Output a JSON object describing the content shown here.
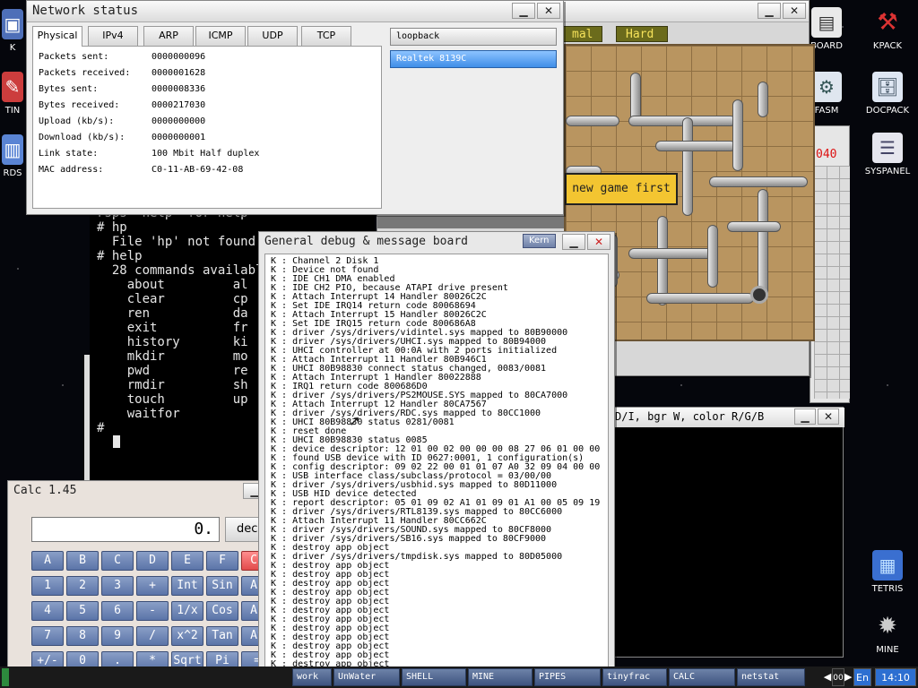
{
  "desktop_icons": {
    "board": "BOARD",
    "kpack": "KPACK",
    "fasm": "FASM",
    "docpack": "DOCPACK",
    "syspanel": "SYSPANEL",
    "tetris": "TETRIS",
    "mine": "MINE",
    "left_partial_1": "K",
    "left_partial_2": "TIN",
    "left_partial_3": "RDS"
  },
  "pipes": {
    "difficulty_normal": "mal",
    "difficulty_hard": "Hard",
    "message": "new game first",
    "counter": "040"
  },
  "video_window": {
    "title": "D/I, bgr W, color R/G/B"
  },
  "shell": {
    "lines": [
      "rsps  help  for help",
      "# hp",
      "  File 'hp' not found.",
      "# help",
      "  28 commands availabl",
      "    about         al",
      "    clear         cp",
      "    ren           da",
      "    exit          fr",
      "    history       ki",
      "    mkdir         mo",
      "    pwd           re",
      "    rmdir         sh",
      "    touch         up",
      "    waitfor",
      "# "
    ]
  },
  "calc": {
    "title": "Calc 1.45",
    "display": "0.",
    "mode": "dec",
    "rows": [
      [
        "A",
        "B",
        "C",
        "D",
        "E",
        "F",
        "CL"
      ],
      [
        "1",
        "2",
        "3",
        "+",
        "Int",
        "Sin",
        "As"
      ],
      [
        "4",
        "5",
        "6",
        "-",
        "1/x",
        "Cos",
        "Ac"
      ],
      [
        "7",
        "8",
        "9",
        "/",
        "x^2",
        "Tan",
        "At"
      ],
      [
        "+/-",
        "0",
        ".",
        "*",
        "Sqrt",
        "Pi",
        "="
      ]
    ]
  },
  "debug": {
    "title": "General debug & message board",
    "kern_label": "Kern",
    "lines": [
      "K : Channel 2 Disk 1",
      "K : Device not found",
      "K : IDE CH1 DMA enabled",
      "K : IDE CH2 PIO, because ATAPI drive present",
      "K : Attach Interrupt 14 Handler 80026C2C",
      "K : Set IDE IRQ14 return code 80068694",
      "K : Attach Interrupt 15 Handler 80026C2C",
      "K : Set IDE IRQ15 return code 800686A8",
      "K : driver /sys/drivers/vidintel.sys mapped to 80B90000",
      "K : driver /sys/drivers/UHCI.sys mapped to 80B94000",
      "K : UHCI controller at 00:0A with 2 ports initialized",
      "K : Attach Interrupt 11 Handler 80B946C1",
      "K : UHCI 80B98830 connect status changed, 0083/0081",
      "K : Attach Interrupt 1 Handler 80022888",
      "K : IRQ1 return code 800686D0",
      "K : driver /sys/drivers/PS2MOUSE.SYS mapped to 80CA7000",
      "K : Attach Interrupt 12 Handler 80CA7567",
      "K : driver /sys/drivers/RDC.sys mapped to 80CC1000",
      "K : UHCI 80B98830 status 0281/0081",
      "K : reset done",
      "K : UHCI 80B98830 status 0085",
      "K : device descriptor: 12 01 00 02 00 00 00 08 27 06 01 00 00",
      "K : found USB device with ID 0627:0001, 1 configuration(s)",
      "K : config descriptor: 09 02 22 00 01 01 07 A0 32 09 04 00 00",
      "K : USB interface class/subclass/protocol = 03/00/00",
      "K : driver /sys/drivers/usbhid.sys mapped to 80D11000",
      "K : USB HID device detected",
      "K : report descriptor: 05 01 09 02 A1 01 09 01 A1 00 05 09 19",
      "K : driver /sys/drivers/RTL8139.sys mapped to 80CC6000",
      "K : Attach Interrupt 11 Handler 80CC662C",
      "K : driver /sys/drivers/SOUND.sys mapped to 80CF8000",
      "K : driver /sys/drivers/SB16.sys mapped to 80CF9000",
      "K : destroy app object",
      "K : driver /sys/drivers/tmpdisk.sys mapped to 80D05000",
      "K : destroy app object",
      "K : destroy app object",
      "K : destroy app object",
      "K : destroy app object",
      "K : destroy app object",
      "K : destroy app object",
      "K : destroy app object",
      "K : destroy app object",
      "K : destroy app object",
      "K : destroy app object",
      "K : destroy app object",
      "K : destroy app object"
    ]
  },
  "network": {
    "title": "Network status",
    "tabs": [
      "Physical",
      "IPv4",
      "ARP",
      "ICMP",
      "UDP",
      "TCP"
    ],
    "active_tab": "Physical",
    "rows": [
      {
        "label": "Packets sent:",
        "value": "0000000096"
      },
      {
        "label": "Packets received:",
        "value": "0000001628"
      },
      {
        "label": "Bytes sent:",
        "value": "0000008336"
      },
      {
        "label": "Bytes received:",
        "value": "0000217030"
      },
      {
        "label": "Upload (kb/s):",
        "value": "0000000000"
      },
      {
        "label": "Download (kb/s):",
        "value": "0000000001"
      },
      {
        "label": "Link state:",
        "value": "100 Mbit Half duplex"
      },
      {
        "label": "MAC address:",
        "value": "C0-11-AB-69-42-08"
      }
    ],
    "interfaces": [
      "loopback",
      "Realtek 8139C"
    ],
    "selected_interface": "Realtek 8139C"
  },
  "taskbar": {
    "items": [
      "work",
      "UnWater",
      "SHELL",
      "MINE",
      "PIPES",
      "tinyfrac",
      "CALC",
      "netstat"
    ],
    "lang": "En",
    "clock": "14:10",
    "pager": "00"
  },
  "colors": {
    "pipes_board": "#b99560",
    "active_interface": "#3f8ee8",
    "calc_button": "#5b74a8",
    "calc_clear": "#e24b4b",
    "taskbar_button": "#3e5480",
    "pipes_message_bg": "#f3c531"
  }
}
